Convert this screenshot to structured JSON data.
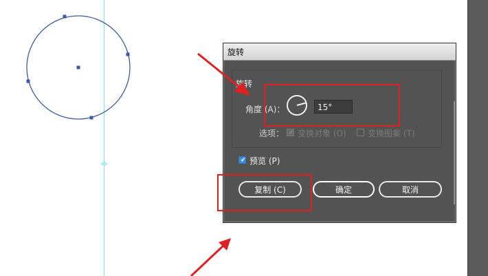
{
  "dialog": {
    "title": "旋转",
    "group_label": "旋转",
    "angle_label": "角度 (A)：",
    "angle_value": "15°",
    "options_label": "选项：",
    "option_transform_objects": "变换对象 (O)",
    "option_transform_pattern": "变换图案 (T)",
    "preview_label": "预览 (P)",
    "copy_button": "复制 (C)",
    "ok_button": "确定",
    "cancel_button": "取消"
  },
  "colors": {
    "annotation_red": "#e02020",
    "guide_cyan": "#7fe3ef",
    "shape_stroke": "#3b5aa0"
  }
}
